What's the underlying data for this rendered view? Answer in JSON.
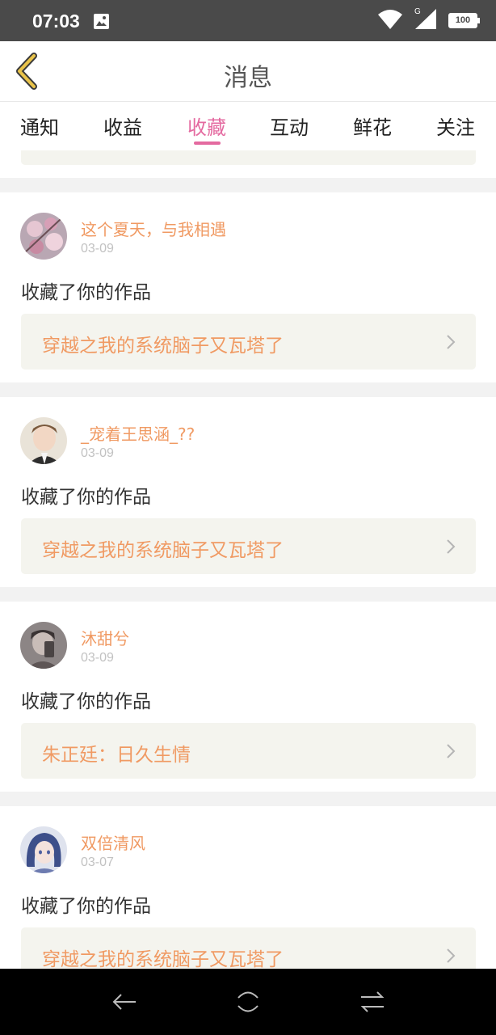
{
  "status_bar": {
    "time": "07:03",
    "network": "G",
    "battery": "100"
  },
  "header": {
    "title": "消息",
    "back_icon": "chevron-left-icon"
  },
  "tabs": [
    {
      "label": "通知",
      "active": false
    },
    {
      "label": "收益",
      "active": false
    },
    {
      "label": "收藏",
      "active": true
    },
    {
      "label": "互动",
      "active": false
    },
    {
      "label": "鲜花",
      "active": false
    },
    {
      "label": "关注",
      "active": false
    }
  ],
  "notifications": [
    {
      "username": "这个夏天，与我相遇",
      "date": "03-09",
      "action": "收藏了你的作品",
      "work_title": "穿越之我的系统脑子又瓦塔了"
    },
    {
      "username": "_宠着王思涵_??",
      "date": "03-09",
      "action": "收藏了你的作品",
      "work_title": "穿越之我的系统脑子又瓦塔了"
    },
    {
      "username": "沐甜兮",
      "date": "03-09",
      "action": "收藏了你的作品",
      "work_title": "朱正廷：日久生情"
    },
    {
      "username": "双倍清风",
      "date": "03-07",
      "action": "收藏了你的作品",
      "work_title": "穿越之我的系统脑子又瓦塔了"
    }
  ],
  "colors": {
    "accent": "#e46aa0",
    "username": "#f09a63",
    "card_link_bg": "#f4f4ee"
  }
}
